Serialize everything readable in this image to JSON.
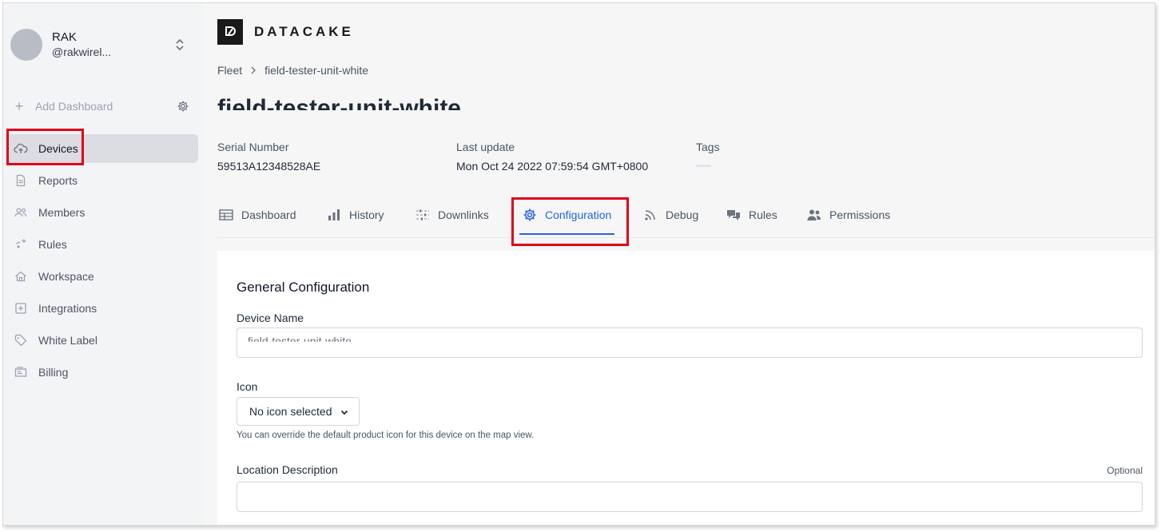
{
  "sidebar": {
    "user": {
      "name": "RAK",
      "handle": "@rakwirel..."
    },
    "add_dashboard": "Add Dashboard",
    "items": [
      {
        "label": "Devices",
        "icon": "cloud-upload-icon"
      },
      {
        "label": "Reports",
        "icon": "document-icon"
      },
      {
        "label": "Members",
        "icon": "users-icon"
      },
      {
        "label": "Rules",
        "icon": "signal-icon"
      },
      {
        "label": "Workspace",
        "icon": "home-icon"
      },
      {
        "label": "Integrations",
        "icon": "plus-square-icon"
      },
      {
        "label": "White Label",
        "icon": "tag-icon"
      },
      {
        "label": "Billing",
        "icon": "billing-icon"
      }
    ]
  },
  "header": {
    "brand": "DATACAKE",
    "breadcrumb": {
      "root": "Fleet",
      "current": "field-tester-unit-white"
    },
    "title": "field-tester-unit-white"
  },
  "meta": {
    "serial_label": "Serial Number",
    "serial_value": "59513A12348528AE",
    "update_label": "Last update",
    "update_value": "Mon Oct 24 2022 07:59:54 GMT+0800",
    "tags_label": "Tags"
  },
  "tabs": [
    {
      "label": "Dashboard",
      "icon": "table-icon"
    },
    {
      "label": "History",
      "icon": "bar-chart-icon"
    },
    {
      "label": "Downlinks",
      "icon": "sliders-icon"
    },
    {
      "label": "Configuration",
      "icon": "cog-icon",
      "active": true
    },
    {
      "label": "Debug",
      "icon": "rss-icon"
    },
    {
      "label": "Rules",
      "icon": "chat-icon"
    },
    {
      "label": "Permissions",
      "icon": "user-group-icon"
    }
  ],
  "config": {
    "section_title": "General Configuration",
    "device_name_label": "Device Name",
    "device_name_value": "field-tester-unit-white",
    "icon_label": "Icon",
    "icon_select_value": "No icon selected",
    "icon_help": "You can override the default product icon for this device on the map view.",
    "location_label": "Location Description",
    "location_optional": "Optional",
    "location_value": ""
  },
  "colors": {
    "accent": "#2563eb",
    "highlight": "#e0001b",
    "sidebar_bg": "#f3f4f6"
  }
}
